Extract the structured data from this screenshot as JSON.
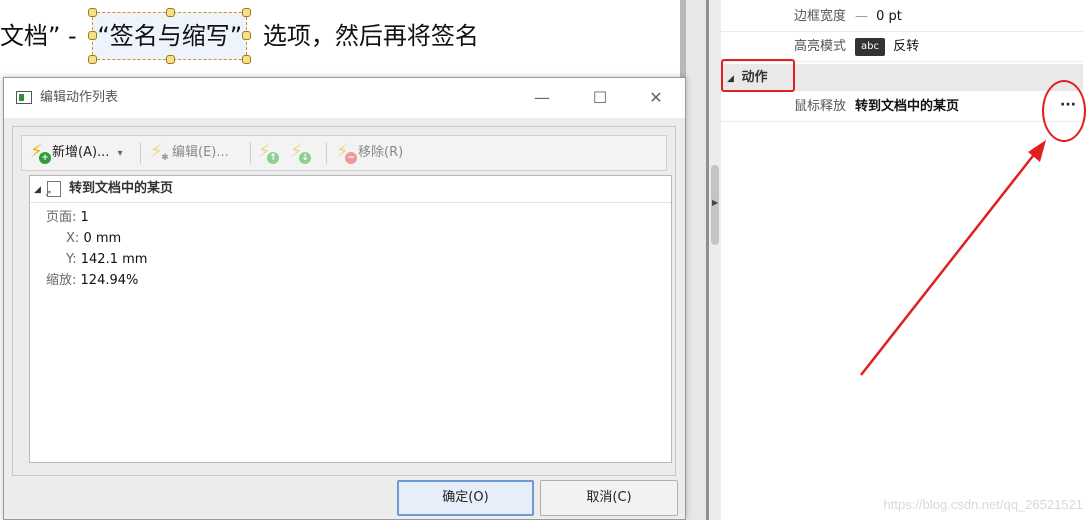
{
  "document": {
    "text_before": "文档”  -",
    "selected_text": "“签名与缩写”",
    "text_after": "选项，然后再将签名"
  },
  "dialog": {
    "title": "编辑动作列表",
    "window_buttons": {
      "minimize": "—",
      "maximize": "☐",
      "close": "✕"
    },
    "toolbar": {
      "add": "新增(A)...",
      "add_dropdown": "▾",
      "edit": "编辑(E)...",
      "remove": "移除(R)"
    },
    "action_item": {
      "expand_glyph": "◢",
      "title": "转到文档中的某页",
      "details": [
        {
          "key": "页面:",
          "value": "1"
        },
        {
          "key": "X:",
          "value": "0 mm"
        },
        {
          "key": "Y:",
          "value": "142.1 mm"
        },
        {
          "key": "缩放:",
          "value": "124.94%"
        }
      ]
    },
    "buttons": {
      "ok": "确定(O)",
      "cancel": "取消(C)"
    }
  },
  "properties": {
    "rows": [
      {
        "label": "边框宽度",
        "value": "0 pt",
        "prefix": "—"
      },
      {
        "label": "高亮模式",
        "swatch": "abc",
        "value": "反转"
      }
    ],
    "category": {
      "expand_glyph": "◢",
      "label": "动作"
    },
    "action_row": {
      "label": "鼠标释放",
      "value": "转到文档中的某页",
      "button": "···"
    }
  },
  "colors": {
    "annotation_red": "#e02020",
    "selection_orange": "#e08a2a"
  },
  "watermark": "https://blog.csdn.net/qq_26521521"
}
